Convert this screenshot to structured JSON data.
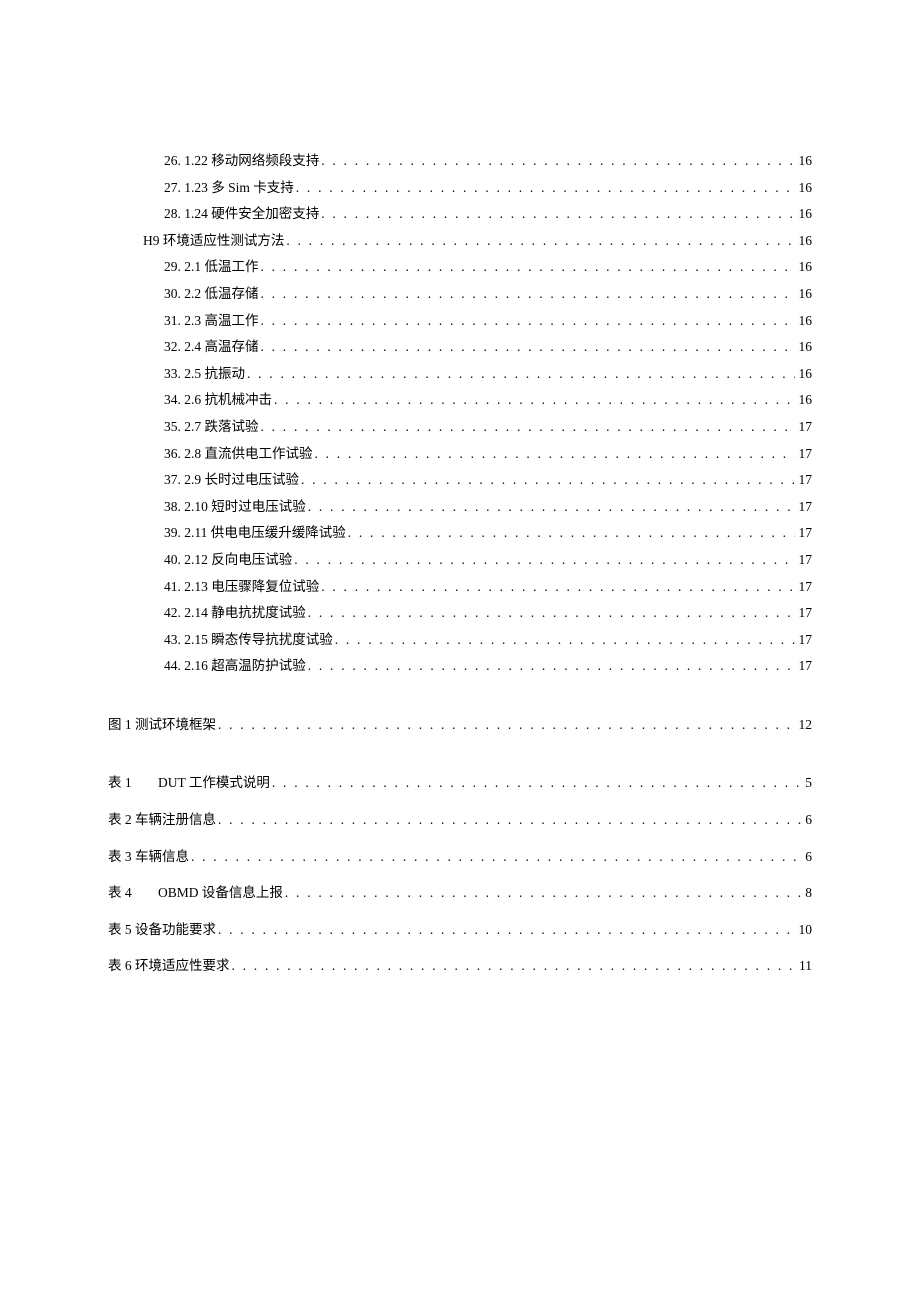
{
  "toc": {
    "items_level2": [
      {
        "num": "26.",
        "section": "1.22",
        "title": "移动网络频段支持",
        "page": "16"
      },
      {
        "num": "27.",
        "section": "1.23",
        "title": "多 Sim 卡支持",
        "page": "16"
      },
      {
        "num": "28.",
        "section": "1.24",
        "title": "硬件安全加密支持",
        "page": "16"
      }
    ],
    "h9": {
      "label": "H9 环境适应性测试方法",
      "page": "16"
    },
    "items_level2b": [
      {
        "num": "29.",
        "section": "2.1",
        "title": "低温工作",
        "page": "16"
      },
      {
        "num": "30.",
        "section": "2.2",
        "title": "低温存储",
        "page": "16"
      },
      {
        "num": "31.",
        "section": "2.3",
        "title": "高温工作",
        "page": "16"
      },
      {
        "num": "32.",
        "section": "2.4",
        "title": "高温存储",
        "page": "16"
      },
      {
        "num": "33.",
        "section": "2.5",
        "title": "抗振动",
        "page": "16"
      },
      {
        "num": "34.",
        "section": "2.6",
        "title": "抗机械冲击",
        "page": "16"
      },
      {
        "num": "35.",
        "section": "2.7",
        "title": "跌落试验",
        "page": "17"
      },
      {
        "num": "36.",
        "section": "2.8",
        "title": "直流供电工作试验",
        "page": "17"
      },
      {
        "num": "37.",
        "section": "2.9",
        "title": "长时过电压试验",
        "page": "17"
      },
      {
        "num": "38.",
        "section": "2.10",
        "title": "短时过电压试验",
        "page": "17"
      },
      {
        "num": "39.",
        "section": "2.11",
        "title": "供电电压缓升缓降试验",
        "page": "17"
      },
      {
        "num": "40.",
        "section": "2.12",
        "title": "反向电压试验",
        "page": "17"
      },
      {
        "num": "41.",
        "section": "2.13",
        "title": "电压骤降复位试验",
        "page": "17"
      },
      {
        "num": "42.",
        "section": "2.14",
        "title": "静电抗扰度试验",
        "page": "17"
      },
      {
        "num": "43.",
        "section": "2.15",
        "title": "瞬态传导抗扰度试验",
        "page": "17"
      },
      {
        "num": "44.",
        "section": "2.16",
        "title": "超高温防护试验",
        "page": "17"
      }
    ],
    "figures": [
      {
        "prefix": "图 1",
        "title": "测试环境框架",
        "page": "12"
      }
    ],
    "tables": [
      {
        "prefix": "表 1",
        "title": "DUT 工作模式说明",
        "page": "5",
        "spaced": true
      },
      {
        "prefix": "表 2",
        "title": "车辆注册信息",
        "page": "6",
        "spaced": false
      },
      {
        "prefix": "表 3",
        "title": "车辆信息",
        "page": "6",
        "spaced": false
      },
      {
        "prefix": "表 4",
        "title": "OBMD 设备信息上报",
        "page": "8",
        "spaced": true
      },
      {
        "prefix": "表 5",
        "title": "设备功能要求",
        "page": "10",
        "spaced": false
      },
      {
        "prefix": "表 6",
        "title": "环境适应性要求",
        "page": "11",
        "spaced": false
      }
    ]
  }
}
